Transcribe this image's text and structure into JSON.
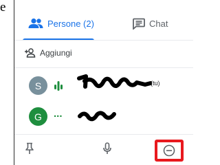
{
  "edge_letter": "e",
  "tabs": {
    "people": {
      "label": "Persone (2)",
      "icon": "people-icon",
      "selected": true
    },
    "chat": {
      "label": "Chat",
      "icon": "chat-icon"
    }
  },
  "add_people": {
    "label": "Aggiungi",
    "icon": "add-person-icon"
  },
  "participants": [
    {
      "initial": "S",
      "avatar_color": "#78909c",
      "status": "speaking-indicator",
      "self_tag": "(tu)"
    },
    {
      "initial": "G",
      "avatar_color": "#1e8e3e",
      "status": "more-dots",
      "more_dots": "..."
    }
  ],
  "bottom_bar": {
    "pin": {
      "icon": "pin-icon"
    },
    "mic": {
      "icon": "microphone-icon"
    },
    "remove": {
      "icon": "remove-circle-icon",
      "highlight_color": "#e8191e"
    }
  },
  "colors": {
    "accent": "#1a73e8",
    "text_secondary": "#5f6368",
    "speaking_green": "#1e8e3e"
  }
}
